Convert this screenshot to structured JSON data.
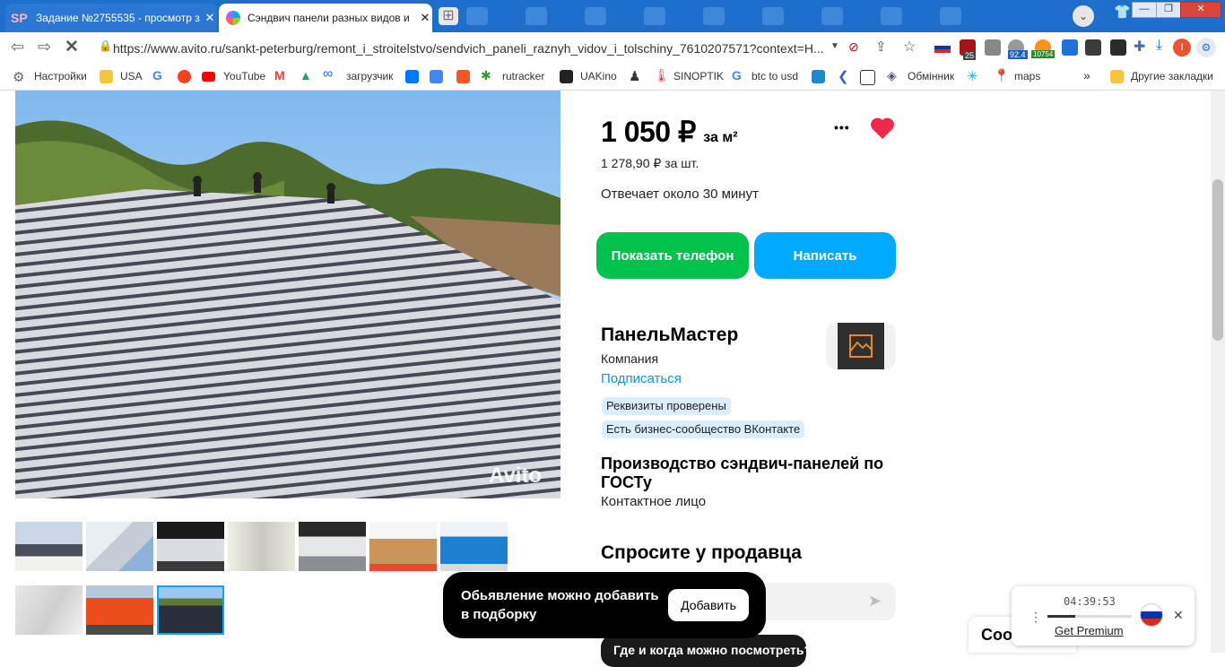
{
  "browser": {
    "tabs": [
      {
        "label": "Задание №2755535 - просмотр з",
        "favicon_text": "SP"
      },
      {
        "label": "Сэндвич панели разных видов и"
      }
    ],
    "url": "https://www.avito.ru/sankt-peterburg/remont_i_stroitelstvo/sendvich_paneli_raznyh_vidov_i_tolschiny_7610207571?context=H...",
    "ext_badges": {
      "b1": "25",
      "b2": "92.4",
      "b3": "10754"
    },
    "profile_initial": "I"
  },
  "bookmarks": {
    "items": [
      {
        "label": "Настройки"
      },
      {
        "label": "USA"
      },
      {
        "label": "YouTube"
      },
      {
        "label": "загрузчик"
      },
      {
        "label": "rutracker"
      },
      {
        "label": "UAKino"
      },
      {
        "label": "SINOPTIK"
      },
      {
        "label": "btc to usd"
      },
      {
        "label": "Обмінник"
      },
      {
        "label": "maps"
      }
    ],
    "more": "»",
    "other": "Другие закладки"
  },
  "listing": {
    "watermark": "Avito",
    "price_value": "1 050 ₽",
    "price_unit": "за м²",
    "price_per_piece": "1 278,90 ₽ за шт.",
    "response_time": "Отвечает около 30 минут",
    "more_icon": "•••",
    "show_phone": "Показать телефон",
    "write": "Написать",
    "colors": {
      "green": "#00c24d",
      "blue": "#00aaff",
      "heart": "#f0284a"
    }
  },
  "seller": {
    "name": "ПанельМастер",
    "type": "Компания",
    "subscribe": "Подписаться",
    "badges": [
      "Реквизиты проверены",
      "Есть бизнес-сообщество ВКонтакте"
    ],
    "description": "Производство сэндвич-панелей по ГОСТу",
    "contact": "Контактное лицо"
  },
  "ask": {
    "title": "Спросите у продавца",
    "question_chip": "Где и когда можно посмотреть?"
  },
  "toast": {
    "text": "Обьявление можно добавить в подборку",
    "button": "Добавить"
  },
  "player": {
    "time": "04:39:53",
    "premium": "Get Premium",
    "progress": 0.33
  },
  "partial_heading": "Coo"
}
